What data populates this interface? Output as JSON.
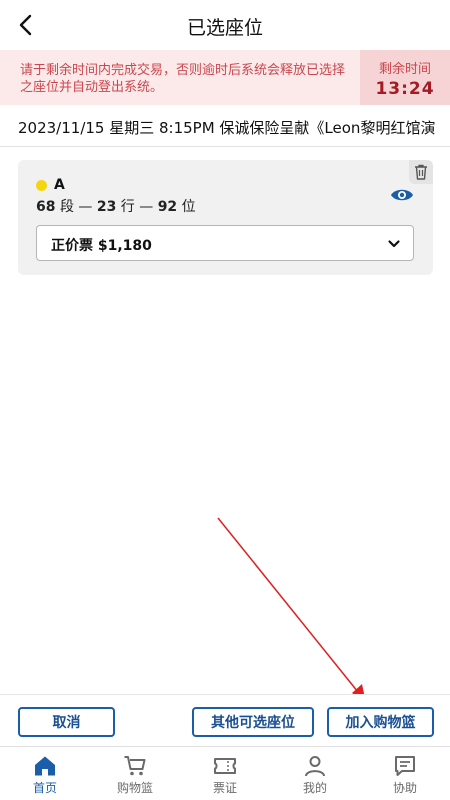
{
  "header": {
    "title": "已选座位"
  },
  "timer": {
    "message": "请于剩余时间内完成交易，否则逾时后系统会释放已选择之座位并自动登出系统。",
    "label": "剩余时间",
    "value": "13:24"
  },
  "event": {
    "info": "2023/11/15 星期三 8:15PM 保诚保险呈献《Leon黎明红馆演"
  },
  "seat": {
    "zone": "A",
    "zone_color": "#f5d60c",
    "section": "68",
    "section_unit": "段",
    "row": "23",
    "row_unit": "行",
    "seat_no": "92",
    "seat_unit": "位",
    "separator": "—",
    "ticket_type": "正价票 $1,180"
  },
  "actions": {
    "cancel": "取消",
    "other_seats": "其他可选座位",
    "add_to_cart": "加入购物篮"
  },
  "tabs": [
    {
      "label": "首页",
      "icon": "home-icon",
      "active": true
    },
    {
      "label": "购物篮",
      "icon": "cart-icon",
      "active": false
    },
    {
      "label": "票证",
      "icon": "ticket-icon",
      "active": false
    },
    {
      "label": "我的",
      "icon": "user-icon",
      "active": false
    },
    {
      "label": "协助",
      "icon": "help-icon",
      "active": false
    }
  ],
  "colors": {
    "accent": "#1a5da8",
    "timer_bg": "#fce9ea",
    "timer_text": "#a31b24",
    "annotation_arrow": "#e02020"
  }
}
